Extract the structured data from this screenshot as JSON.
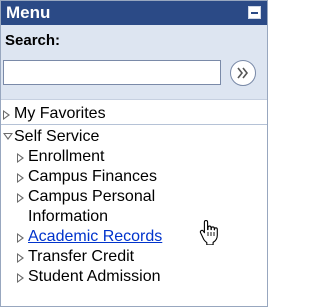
{
  "menu": {
    "title": "Menu",
    "collapse_icon": "minus-icon"
  },
  "search": {
    "label": "Search:",
    "value": "",
    "placeholder": "",
    "go_icon": "double-chevron-right-icon"
  },
  "nav": {
    "my_favorites": "My Favorites",
    "self_service": "Self Service",
    "items": [
      {
        "label": "Enrollment"
      },
      {
        "label": "Campus Finances"
      },
      {
        "label_line1": "Campus Personal",
        "label_line2": "Information"
      },
      {
        "label": "Academic Records"
      },
      {
        "label": "Transfer Credit"
      },
      {
        "label": "Student Admission"
      }
    ]
  },
  "colors": {
    "header_bg": "#2b4a86",
    "search_bg": "#dde5f1",
    "link": "#0033cc"
  },
  "cursor_icon": "hand-pointer-icon"
}
